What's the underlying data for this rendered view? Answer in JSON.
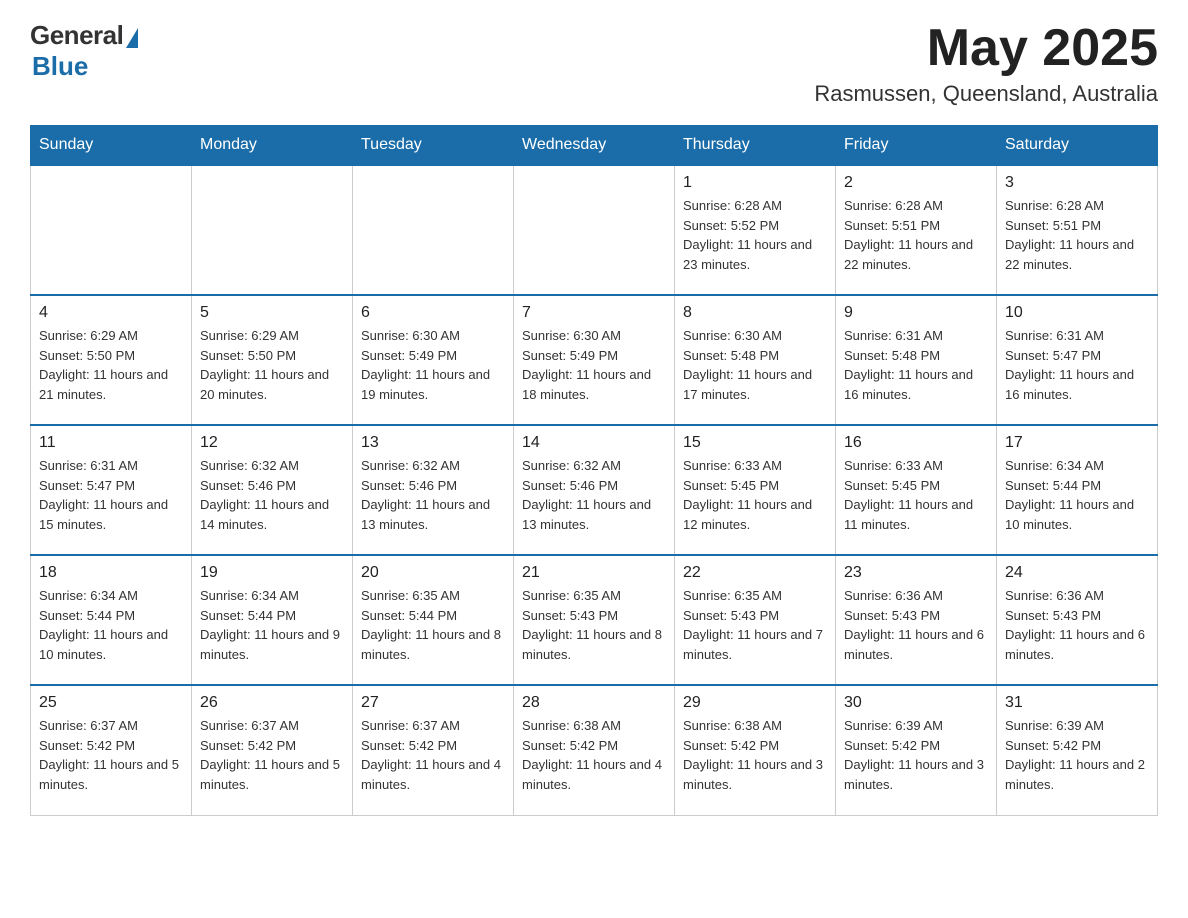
{
  "logo": {
    "general": "General",
    "blue": "Blue"
  },
  "header": {
    "month": "May 2025",
    "location": "Rasmussen, Queensland, Australia"
  },
  "weekdays": [
    "Sunday",
    "Monday",
    "Tuesday",
    "Wednesday",
    "Thursday",
    "Friday",
    "Saturday"
  ],
  "weeks": [
    [
      {
        "day": "",
        "info": ""
      },
      {
        "day": "",
        "info": ""
      },
      {
        "day": "",
        "info": ""
      },
      {
        "day": "",
        "info": ""
      },
      {
        "day": "1",
        "info": "Sunrise: 6:28 AM\nSunset: 5:52 PM\nDaylight: 11 hours and 23 minutes."
      },
      {
        "day": "2",
        "info": "Sunrise: 6:28 AM\nSunset: 5:51 PM\nDaylight: 11 hours and 22 minutes."
      },
      {
        "day": "3",
        "info": "Sunrise: 6:28 AM\nSunset: 5:51 PM\nDaylight: 11 hours and 22 minutes."
      }
    ],
    [
      {
        "day": "4",
        "info": "Sunrise: 6:29 AM\nSunset: 5:50 PM\nDaylight: 11 hours and 21 minutes."
      },
      {
        "day": "5",
        "info": "Sunrise: 6:29 AM\nSunset: 5:50 PM\nDaylight: 11 hours and 20 minutes."
      },
      {
        "day": "6",
        "info": "Sunrise: 6:30 AM\nSunset: 5:49 PM\nDaylight: 11 hours and 19 minutes."
      },
      {
        "day": "7",
        "info": "Sunrise: 6:30 AM\nSunset: 5:49 PM\nDaylight: 11 hours and 18 minutes."
      },
      {
        "day": "8",
        "info": "Sunrise: 6:30 AM\nSunset: 5:48 PM\nDaylight: 11 hours and 17 minutes."
      },
      {
        "day": "9",
        "info": "Sunrise: 6:31 AM\nSunset: 5:48 PM\nDaylight: 11 hours and 16 minutes."
      },
      {
        "day": "10",
        "info": "Sunrise: 6:31 AM\nSunset: 5:47 PM\nDaylight: 11 hours and 16 minutes."
      }
    ],
    [
      {
        "day": "11",
        "info": "Sunrise: 6:31 AM\nSunset: 5:47 PM\nDaylight: 11 hours and 15 minutes."
      },
      {
        "day": "12",
        "info": "Sunrise: 6:32 AM\nSunset: 5:46 PM\nDaylight: 11 hours and 14 minutes."
      },
      {
        "day": "13",
        "info": "Sunrise: 6:32 AM\nSunset: 5:46 PM\nDaylight: 11 hours and 13 minutes."
      },
      {
        "day": "14",
        "info": "Sunrise: 6:32 AM\nSunset: 5:46 PM\nDaylight: 11 hours and 13 minutes."
      },
      {
        "day": "15",
        "info": "Sunrise: 6:33 AM\nSunset: 5:45 PM\nDaylight: 11 hours and 12 minutes."
      },
      {
        "day": "16",
        "info": "Sunrise: 6:33 AM\nSunset: 5:45 PM\nDaylight: 11 hours and 11 minutes."
      },
      {
        "day": "17",
        "info": "Sunrise: 6:34 AM\nSunset: 5:44 PM\nDaylight: 11 hours and 10 minutes."
      }
    ],
    [
      {
        "day": "18",
        "info": "Sunrise: 6:34 AM\nSunset: 5:44 PM\nDaylight: 11 hours and 10 minutes."
      },
      {
        "day": "19",
        "info": "Sunrise: 6:34 AM\nSunset: 5:44 PM\nDaylight: 11 hours and 9 minutes."
      },
      {
        "day": "20",
        "info": "Sunrise: 6:35 AM\nSunset: 5:44 PM\nDaylight: 11 hours and 8 minutes."
      },
      {
        "day": "21",
        "info": "Sunrise: 6:35 AM\nSunset: 5:43 PM\nDaylight: 11 hours and 8 minutes."
      },
      {
        "day": "22",
        "info": "Sunrise: 6:35 AM\nSunset: 5:43 PM\nDaylight: 11 hours and 7 minutes."
      },
      {
        "day": "23",
        "info": "Sunrise: 6:36 AM\nSunset: 5:43 PM\nDaylight: 11 hours and 6 minutes."
      },
      {
        "day": "24",
        "info": "Sunrise: 6:36 AM\nSunset: 5:43 PM\nDaylight: 11 hours and 6 minutes."
      }
    ],
    [
      {
        "day": "25",
        "info": "Sunrise: 6:37 AM\nSunset: 5:42 PM\nDaylight: 11 hours and 5 minutes."
      },
      {
        "day": "26",
        "info": "Sunrise: 6:37 AM\nSunset: 5:42 PM\nDaylight: 11 hours and 5 minutes."
      },
      {
        "day": "27",
        "info": "Sunrise: 6:37 AM\nSunset: 5:42 PM\nDaylight: 11 hours and 4 minutes."
      },
      {
        "day": "28",
        "info": "Sunrise: 6:38 AM\nSunset: 5:42 PM\nDaylight: 11 hours and 4 minutes."
      },
      {
        "day": "29",
        "info": "Sunrise: 6:38 AM\nSunset: 5:42 PM\nDaylight: 11 hours and 3 minutes."
      },
      {
        "day": "30",
        "info": "Sunrise: 6:39 AM\nSunset: 5:42 PM\nDaylight: 11 hours and 3 minutes."
      },
      {
        "day": "31",
        "info": "Sunrise: 6:39 AM\nSunset: 5:42 PM\nDaylight: 11 hours and 2 minutes."
      }
    ]
  ]
}
